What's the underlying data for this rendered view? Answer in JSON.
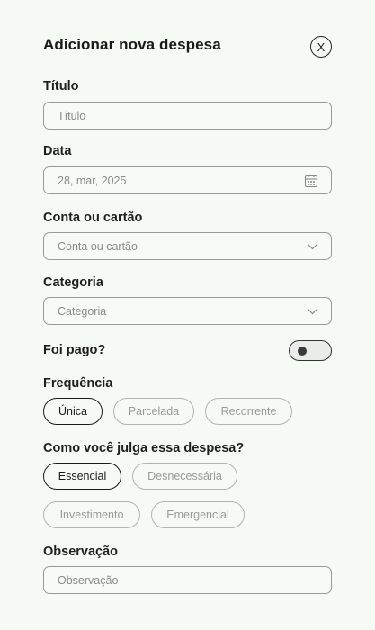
{
  "dialog": {
    "title": "Adicionar nova despesa",
    "close_label": "X"
  },
  "fields": {
    "titulo": {
      "label": "Título",
      "placeholder": "Título"
    },
    "data": {
      "label": "Data",
      "value": "28, mar, 2025",
      "icon": "calendar-icon"
    },
    "conta": {
      "label": "Conta ou cartão",
      "placeholder": "Conta ou cartão",
      "icon": "chevron-down-icon"
    },
    "categoria": {
      "label": "Categoria",
      "placeholder": "Categoria",
      "icon": "chevron-down-icon"
    },
    "observacao": {
      "label": "Observação",
      "placeholder": "Observação"
    }
  },
  "pago": {
    "label": "Foi pago?",
    "value": false
  },
  "frequencia": {
    "label": "Frequência",
    "options": [
      "Única",
      "Parcelada",
      "Recorrente"
    ],
    "selected": "Única"
  },
  "julgamento": {
    "label": "Como você julga essa despesa?",
    "options": [
      "Essencial",
      "Desnecessária",
      "Investimento",
      "Emergencial"
    ],
    "selected": "Essencial"
  },
  "colors": {
    "background": "#f5faf4",
    "border": "#9a9a9a",
    "text": "#1a1a1a",
    "muted": "#8a8a8a"
  }
}
